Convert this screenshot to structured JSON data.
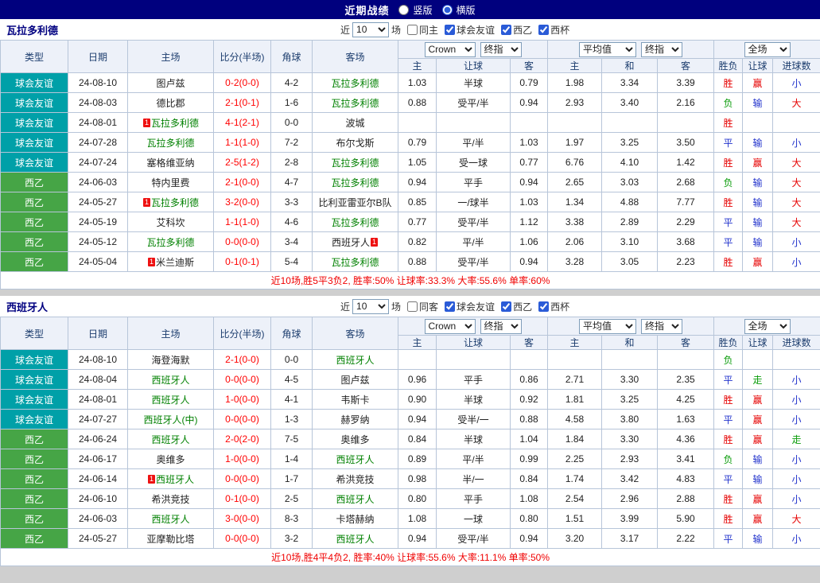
{
  "top_bar": {
    "title": "近期战绩",
    "options": [
      {
        "label": "竖版",
        "selected": false
      },
      {
        "label": "横版",
        "selected": true
      }
    ]
  },
  "table_header": {
    "type": "类型",
    "date": "日期",
    "home": "主场",
    "score": "比分(半场)",
    "corner": "角球",
    "away": "客场",
    "odds_source_select": "Crown",
    "odds_final_select": "终指",
    "avg_select": "平均值",
    "avg_final_select": "终指",
    "fulltime_select": "全场",
    "sub": [
      "主",
      "让球",
      "客",
      "主",
      "和",
      "客",
      "胜负",
      "让球",
      "进球数"
    ]
  },
  "sections": [
    {
      "team": "瓦拉多利德",
      "filter": {
        "recent": "近",
        "count": "10",
        "matches": "场",
        "venue": {
          "label": "同主",
          "checked": false
        },
        "competitions": [
          {
            "label": "球会友谊",
            "checked": true
          },
          {
            "label": "西乙",
            "checked": true
          },
          {
            "label": "西杯",
            "checked": true
          }
        ]
      },
      "rows": [
        {
          "league": "friendly",
          "type": "球会友谊",
          "date": "24-08-10",
          "home": {
            "name": "图卢兹",
            "subject": false,
            "badge": false
          },
          "score": "0-2(0-0)",
          "corner": "4-2",
          "away": {
            "name": "瓦拉多利德",
            "subject": true,
            "badge": false
          },
          "odds": [
            "1.03",
            "半球",
            "0.79",
            "1.98",
            "3.34",
            "3.39"
          ],
          "results": [
            "胜",
            "赢",
            "小"
          ]
        },
        {
          "league": "friendly",
          "type": "球会友谊",
          "date": "24-08-03",
          "home": {
            "name": "德比郡",
            "subject": false,
            "badge": false
          },
          "score": "2-1(0-1)",
          "corner": "1-6",
          "away": {
            "name": "瓦拉多利德",
            "subject": true,
            "badge": false
          },
          "odds": [
            "0.88",
            "受平/半",
            "0.94",
            "2.93",
            "3.40",
            "2.16"
          ],
          "results": [
            "负",
            "输",
            "大"
          ]
        },
        {
          "league": "friendly",
          "type": "球会友谊",
          "date": "24-08-01",
          "home": {
            "name": "瓦拉多利德",
            "subject": true,
            "badge": true
          },
          "score": "4-1(2-1)",
          "corner": "0-0",
          "away": {
            "name": "波城",
            "subject": false,
            "badge": false
          },
          "odds": [
            "",
            "",
            "",
            "",
            "",
            ""
          ],
          "results": [
            "胜",
            "",
            ""
          ]
        },
        {
          "league": "friendly",
          "type": "球会友谊",
          "date": "24-07-28",
          "home": {
            "name": "瓦拉多利德",
            "subject": true,
            "badge": false
          },
          "score": "1-1(1-0)",
          "corner": "7-2",
          "away": {
            "name": "布尔戈斯",
            "subject": false,
            "badge": false
          },
          "odds": [
            "0.79",
            "平/半",
            "1.03",
            "1.97",
            "3.25",
            "3.50"
          ],
          "results": [
            "平",
            "输",
            "小"
          ]
        },
        {
          "league": "friendly",
          "type": "球会友谊",
          "date": "24-07-24",
          "home": {
            "name": "塞格维亚纳",
            "subject": false,
            "badge": false
          },
          "score": "2-5(1-2)",
          "corner": "2-8",
          "away": {
            "name": "瓦拉多利德",
            "subject": true,
            "badge": false
          },
          "odds": [
            "1.05",
            "受一球",
            "0.77",
            "6.76",
            "4.10",
            "1.42"
          ],
          "results": [
            "胜",
            "赢",
            "大"
          ]
        },
        {
          "league": "liga2",
          "type": "西乙",
          "date": "24-06-03",
          "home": {
            "name": "特内里费",
            "subject": false,
            "badge": false
          },
          "score": "2-1(0-0)",
          "corner": "4-7",
          "away": {
            "name": "瓦拉多利德",
            "subject": true,
            "badge": false
          },
          "odds": [
            "0.94",
            "平手",
            "0.94",
            "2.65",
            "3.03",
            "2.68"
          ],
          "results": [
            "负",
            "输",
            "大"
          ]
        },
        {
          "league": "liga2",
          "type": "西乙",
          "date": "24-05-27",
          "home": {
            "name": "瓦拉多利德",
            "subject": true,
            "badge": true
          },
          "score": "3-2(0-0)",
          "corner": "3-3",
          "away": {
            "name": "比利亚雷亚尔B队",
            "subject": false,
            "badge": false
          },
          "odds": [
            "0.85",
            "一/球半",
            "1.03",
            "1.34",
            "4.88",
            "7.77"
          ],
          "results": [
            "胜",
            "输",
            "大"
          ]
        },
        {
          "league": "liga2",
          "type": "西乙",
          "date": "24-05-19",
          "home": {
            "name": "艾科坎",
            "subject": false,
            "badge": false
          },
          "score": "1-1(1-0)",
          "corner": "4-6",
          "away": {
            "name": "瓦拉多利德",
            "subject": true,
            "badge": false
          },
          "odds": [
            "0.77",
            "受平/半",
            "1.12",
            "3.38",
            "2.89",
            "2.29"
          ],
          "results": [
            "平",
            "输",
            "大"
          ]
        },
        {
          "league": "liga2",
          "type": "西乙",
          "date": "24-05-12",
          "home": {
            "name": "瓦拉多利德",
            "subject": true,
            "badge": false
          },
          "score": "0-0(0-0)",
          "corner": "3-4",
          "away": {
            "name": "西班牙人",
            "subject": false,
            "badge": true
          },
          "odds": [
            "0.82",
            "平/半",
            "1.06",
            "2.06",
            "3.10",
            "3.68"
          ],
          "results": [
            "平",
            "输",
            "小"
          ]
        },
        {
          "league": "liga2",
          "type": "西乙",
          "date": "24-05-04",
          "home": {
            "name": "米兰迪斯",
            "subject": false,
            "badge": true
          },
          "score": "0-1(0-1)",
          "corner": "5-4",
          "away": {
            "name": "瓦拉多利德",
            "subject": true,
            "badge": false
          },
          "odds": [
            "0.88",
            "受平/半",
            "0.94",
            "3.28",
            "3.05",
            "2.23"
          ],
          "results": [
            "胜",
            "赢",
            "小"
          ]
        }
      ],
      "summary": "近10场,胜5平3负2, 胜率:50% 让球率:33.3% 大率:55.6% 单率:60%"
    },
    {
      "team": "西班牙人",
      "filter": {
        "recent": "近",
        "count": "10",
        "matches": "场",
        "venue": {
          "label": "同客",
          "checked": false
        },
        "competitions": [
          {
            "label": "球会友谊",
            "checked": true
          },
          {
            "label": "西乙",
            "checked": true
          },
          {
            "label": "西杯",
            "checked": true
          }
        ]
      },
      "rows": [
        {
          "league": "friendly",
          "type": "球会友谊",
          "date": "24-08-10",
          "home": {
            "name": "海登海默",
            "subject": false,
            "badge": false
          },
          "score": "2-1(0-0)",
          "corner": "0-0",
          "away": {
            "name": "西班牙人",
            "subject": true,
            "badge": false
          },
          "odds": [
            "",
            "",
            "",
            "",
            "",
            ""
          ],
          "results": [
            "负",
            "",
            ""
          ]
        },
        {
          "league": "friendly",
          "type": "球会友谊",
          "date": "24-08-04",
          "home": {
            "name": "西班牙人",
            "subject": true,
            "badge": false
          },
          "score": "0-0(0-0)",
          "corner": "4-5",
          "away": {
            "name": "图卢兹",
            "subject": false,
            "badge": false
          },
          "odds": [
            "0.96",
            "平手",
            "0.86",
            "2.71",
            "3.30",
            "2.35"
          ],
          "results": [
            "平",
            "走",
            "小"
          ]
        },
        {
          "league": "friendly",
          "type": "球会友谊",
          "date": "24-08-01",
          "home": {
            "name": "西班牙人",
            "subject": true,
            "badge": false
          },
          "score": "1-0(0-0)",
          "corner": "4-1",
          "away": {
            "name": "韦斯卡",
            "subject": false,
            "badge": false
          },
          "odds": [
            "0.90",
            "半球",
            "0.92",
            "1.81",
            "3.25",
            "4.25"
          ],
          "results": [
            "胜",
            "赢",
            "小"
          ]
        },
        {
          "league": "friendly",
          "type": "球会友谊",
          "date": "24-07-27",
          "home": {
            "name": "西班牙人(中)",
            "subject": true,
            "badge": false
          },
          "score": "0-0(0-0)",
          "corner": "1-3",
          "away": {
            "name": "赫罗纳",
            "subject": false,
            "badge": false
          },
          "odds": [
            "0.94",
            "受半/一",
            "0.88",
            "4.58",
            "3.80",
            "1.63"
          ],
          "results": [
            "平",
            "赢",
            "小"
          ]
        },
        {
          "league": "liga2",
          "type": "西乙",
          "date": "24-06-24",
          "home": {
            "name": "西班牙人",
            "subject": true,
            "badge": false
          },
          "score": "2-0(2-0)",
          "corner": "7-5",
          "away": {
            "name": "奥维多",
            "subject": false,
            "badge": false
          },
          "odds": [
            "0.84",
            "半球",
            "1.04",
            "1.84",
            "3.30",
            "4.36"
          ],
          "results": [
            "胜",
            "赢",
            "走"
          ]
        },
        {
          "league": "liga2",
          "type": "西乙",
          "date": "24-06-17",
          "home": {
            "name": "奥维多",
            "subject": false,
            "badge": false
          },
          "score": "1-0(0-0)",
          "corner": "1-4",
          "away": {
            "name": "西班牙人",
            "subject": true,
            "badge": false
          },
          "odds": [
            "0.89",
            "平/半",
            "0.99",
            "2.25",
            "2.93",
            "3.41"
          ],
          "results": [
            "负",
            "输",
            "小"
          ]
        },
        {
          "league": "liga2",
          "type": "西乙",
          "date": "24-06-14",
          "home": {
            "name": "西班牙人",
            "subject": true,
            "badge": true
          },
          "score": "0-0(0-0)",
          "corner": "1-7",
          "away": {
            "name": "希洪竞技",
            "subject": false,
            "badge": false
          },
          "odds": [
            "0.98",
            "半/一",
            "0.84",
            "1.74",
            "3.42",
            "4.83"
          ],
          "results": [
            "平",
            "输",
            "小"
          ]
        },
        {
          "league": "liga2",
          "type": "西乙",
          "date": "24-06-10",
          "home": {
            "name": "希洪竞技",
            "subject": false,
            "badge": false
          },
          "score": "0-1(0-0)",
          "corner": "2-5",
          "away": {
            "name": "西班牙人",
            "subject": true,
            "badge": false
          },
          "odds": [
            "0.80",
            "平手",
            "1.08",
            "2.54",
            "2.96",
            "2.88"
          ],
          "results": [
            "胜",
            "赢",
            "小"
          ]
        },
        {
          "league": "liga2",
          "type": "西乙",
          "date": "24-06-03",
          "home": {
            "name": "西班牙人",
            "subject": true,
            "badge": false
          },
          "score": "3-0(0-0)",
          "corner": "8-3",
          "away": {
            "name": "卡塔赫纳",
            "subject": false,
            "badge": false
          },
          "odds": [
            "1.08",
            "一球",
            "0.80",
            "1.51",
            "3.99",
            "5.90"
          ],
          "results": [
            "胜",
            "赢",
            "大"
          ]
        },
        {
          "league": "liga2",
          "type": "西乙",
          "date": "24-05-27",
          "home": {
            "name": "亚摩勒比塔",
            "subject": false,
            "badge": false
          },
          "score": "0-0(0-0)",
          "corner": "3-2",
          "away": {
            "name": "西班牙人",
            "subject": true,
            "badge": false
          },
          "odds": [
            "0.94",
            "受平/半",
            "0.94",
            "3.20",
            "3.17",
            "2.22"
          ],
          "results": [
            "平",
            "输",
            "小"
          ]
        }
      ],
      "summary": "近10场,胜4平4负2, 胜率:40% 让球率:55.6% 大率:11.1% 单率:50%"
    }
  ],
  "colors": {
    "league_friendly_bg": "#00a0a8",
    "league_liga2_bg": "#46a546",
    "score": "#ff0000",
    "subject_team": "#008000",
    "badge_bg": "#ee1111",
    "result_map": {
      "胜": "#e60000",
      "赢": "#e60000",
      "大": "#e60000",
      "平": "#2233cc",
      "输": "#2233cc",
      "小": "#2233cc",
      "负": "#0a9c0a",
      "走": "#0a9c0a"
    }
  }
}
